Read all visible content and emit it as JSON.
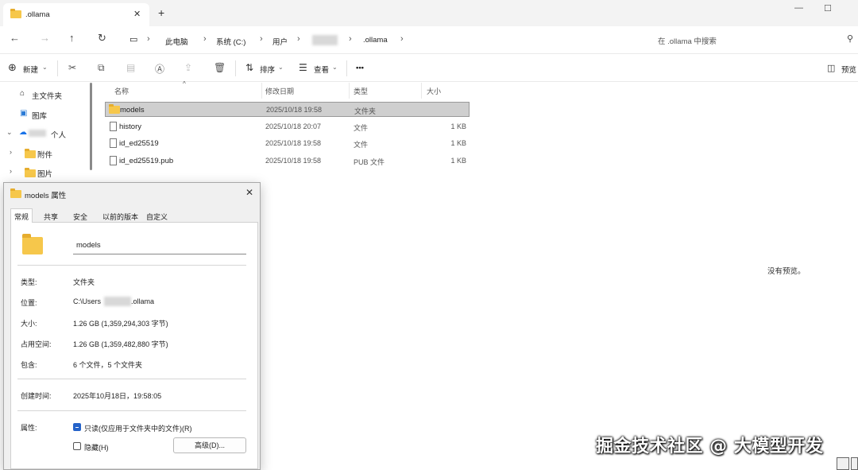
{
  "tab": {
    "title": ".ollama"
  },
  "window": {
    "minimize": "—",
    "maximize": "☐"
  },
  "breadcrumb": {
    "items": [
      "此电脑",
      "系统 (C:)",
      "用户",
      ".ollama"
    ]
  },
  "search": {
    "placeholder": "在 .ollama 中搜索"
  },
  "toolbar": {
    "new_label": "新建",
    "sort_label": "排序",
    "view_label": "查看",
    "more_label": "•••",
    "preview_label": "预览"
  },
  "sidebar": {
    "items": [
      {
        "label": "主文件夹"
      },
      {
        "label": "图库"
      },
      {
        "label": "个人"
      },
      {
        "label": "附件"
      },
      {
        "label": "图片"
      }
    ]
  },
  "columns": {
    "name": "名称",
    "date": "修改日期",
    "type": "类型",
    "size": "大小"
  },
  "files": [
    {
      "name": "models",
      "date": "2025/10/18 19:58",
      "type": "文件夹",
      "size": "",
      "kind": "folder"
    },
    {
      "name": "history",
      "date": "2025/10/18 20:07",
      "type": "文件",
      "size": "1 KB",
      "kind": "file"
    },
    {
      "name": "id_ed25519",
      "date": "2025/10/18 19:58",
      "type": "文件",
      "size": "1 KB",
      "kind": "file"
    },
    {
      "name": "id_ed25519.pub",
      "date": "2025/10/18 19:58",
      "type": "PUB 文件",
      "size": "1 KB",
      "kind": "file"
    }
  ],
  "preview": {
    "empty_text": "没有预览。"
  },
  "dialog": {
    "title": "models 属性",
    "tabs": [
      "常规",
      "共享",
      "安全",
      "以前的版本",
      "自定义"
    ],
    "name_value": "models",
    "props": [
      {
        "label": "类型:",
        "value": "文件夹"
      },
      {
        "label": "位置:",
        "value_prefix": "C:\\Users",
        "value_suffix": ".ollama"
      },
      {
        "label": "大小:",
        "value": "1.26 GB (1,359,294,303 字节)"
      },
      {
        "label": "占用空间:",
        "value": "1.26 GB (1,359,482,880 字节)"
      },
      {
        "label": "包含:",
        "value": "6 个文件，5 个文件夹"
      },
      {
        "label": "创建时间:",
        "value": "2025年10月18日，19:58:05"
      }
    ],
    "attributes_label": "属性:",
    "readonly_label": "只读(仅应用于文件夹中的文件)(R)",
    "readonly_checked": true,
    "hidden_label": "隐藏(H)",
    "hidden_checked": false,
    "advanced_label": "高级(D)..."
  },
  "watermark": "掘金技术社区 @ 大模型开发",
  "colors": {
    "folder": "#f6c74b",
    "selection": "#cfcfcf",
    "accent": "#2563c9"
  }
}
